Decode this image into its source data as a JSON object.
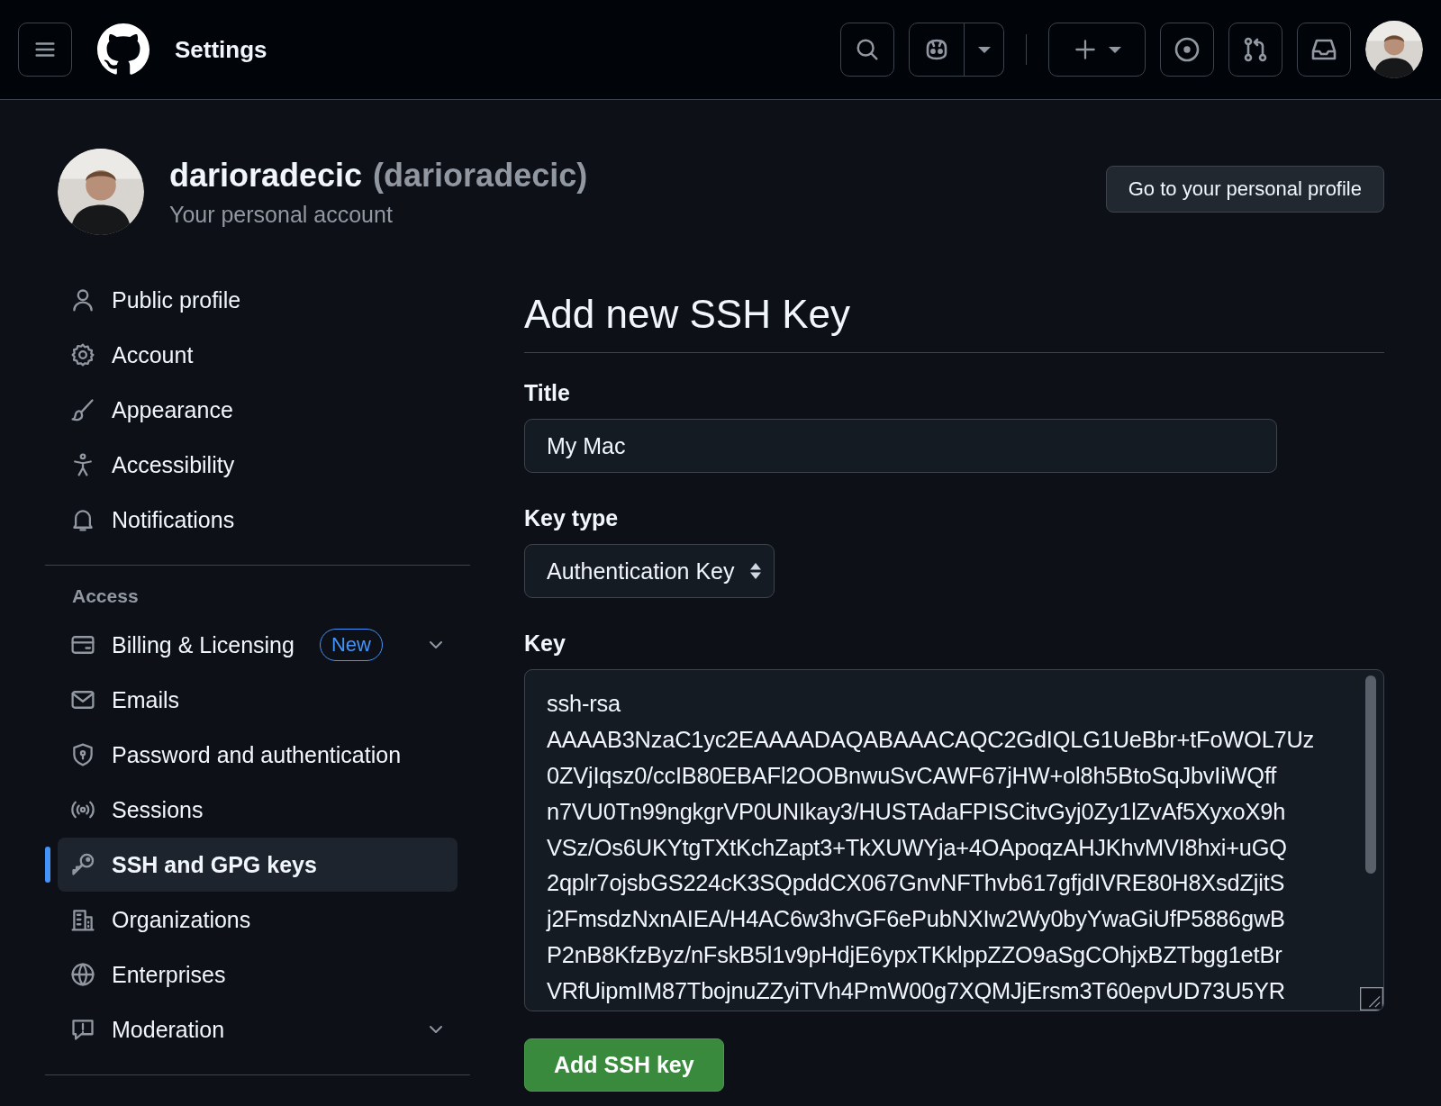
{
  "header": {
    "title": "Settings"
  },
  "account": {
    "name": "darioradecic",
    "handle": "(darioradecic)",
    "subtitle": "Your personal account",
    "profile_button": "Go to your personal profile"
  },
  "sidebar": {
    "groups": [
      {
        "items": [
          {
            "label": "Public profile",
            "selected": false
          },
          {
            "label": "Account",
            "selected": false
          },
          {
            "label": "Appearance",
            "selected": false
          },
          {
            "label": "Accessibility",
            "selected": false
          },
          {
            "label": "Notifications",
            "selected": false
          }
        ]
      },
      {
        "heading": "Access",
        "items": [
          {
            "label": "Billing & Licensing",
            "badge": "New",
            "expanded": false,
            "selected": false
          },
          {
            "label": "Emails",
            "selected": false
          },
          {
            "label": "Password and authentication",
            "selected": false
          },
          {
            "label": "Sessions",
            "selected": false
          },
          {
            "label": "SSH and GPG keys",
            "selected": true
          },
          {
            "label": "Organizations",
            "selected": false
          },
          {
            "label": "Enterprises",
            "selected": false
          },
          {
            "label": "Moderation",
            "expanded": false,
            "selected": false
          }
        ]
      }
    ]
  },
  "form": {
    "heading": "Add new SSH Key",
    "title_field": {
      "label": "Title",
      "value": "My Mac"
    },
    "key_type": {
      "label": "Key type",
      "value": "Authentication Key"
    },
    "key_field": {
      "label": "Key",
      "lines": [
        "ssh-rsa",
        "AAAAB3NzaC1yc2EAAAADAQABAAACAQC2GdIQLG1UeBbr+tFoWOL7Uz",
        "0ZVjIqsz0/ccIB80EBAFl2OOBnwuSvCAWF67jHW+ol8h5BtoSqJbvIiWQff",
        "n7VU0Tn99ngkgrVP0UNIkay3/HUSTAdaFPISCitvGyj0Zy1lZvAf5XyxoX9h",
        "VSz/Os6UKYtgTXtKchZapt3+TkXUWYja+4OApoqzAHJKhvMVI8hxi+uGQ",
        "2qplr7ojsbGS224cK3SQpddCX067GnvNFThvb617gfjdIVRE80H8XsdZjitS",
        "j2FmsdzNxnAIEA/H4AC6w3hvGF6ePubNXIw2Wy0byYwaGiUfP5886gwB",
        "P2nB8KfzByz/nFskB5l1v9pHdjE6ypxTKklppZZO9aSgCOhjxBZTbgg1etBr",
        "VRfUipmIM87TbojnuZZyiTVh4PmW00g7XQMJjErsm3T60epvUD73U5YR"
      ]
    },
    "submit": "Add SSH key"
  }
}
